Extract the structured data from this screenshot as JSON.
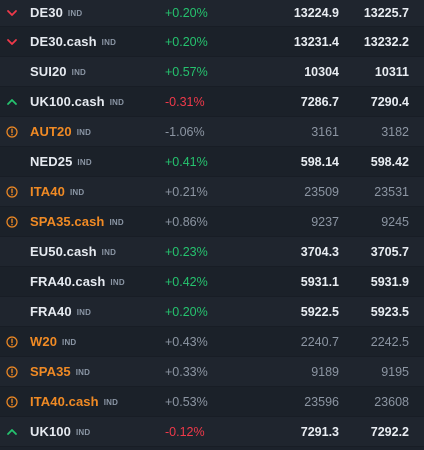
{
  "colors": {
    "positive": "#25c26e",
    "negative": "#f0394a",
    "warning": "#f08a24",
    "muted": "#8c95a2",
    "text": "#e6eaf0",
    "background": "#1c222b"
  },
  "rows": [
    {
      "icon": "chevron-down-icon",
      "symbol": "DE30",
      "tag": "IND",
      "change": "+0.20%",
      "change_dir": "pos",
      "bid": "13224.9",
      "ask": "13225.7",
      "warn": false,
      "dim": false
    },
    {
      "icon": "chevron-down-icon",
      "symbol": "DE30.cash",
      "tag": "IND",
      "change": "+0.20%",
      "change_dir": "pos",
      "bid": "13231.4",
      "ask": "13232.2",
      "warn": false,
      "dim": false
    },
    {
      "icon": "",
      "symbol": "SUI20",
      "tag": "IND",
      "change": "+0.57%",
      "change_dir": "pos",
      "bid": "10304",
      "ask": "10311",
      "warn": false,
      "dim": false
    },
    {
      "icon": "chevron-up-icon",
      "symbol": "UK100.cash",
      "tag": "IND",
      "change": "-0.31%",
      "change_dir": "neg",
      "bid": "7286.7",
      "ask": "7290.4",
      "warn": false,
      "dim": false
    },
    {
      "icon": "info-circle-icon",
      "symbol": "AUT20",
      "tag": "IND",
      "change": "-1.06%",
      "change_dir": "mute",
      "bid": "3161",
      "ask": "3182",
      "warn": true,
      "dim": true
    },
    {
      "icon": "",
      "symbol": "NED25",
      "tag": "IND",
      "change": "+0.41%",
      "change_dir": "pos",
      "bid": "598.14",
      "ask": "598.42",
      "warn": false,
      "dim": false
    },
    {
      "icon": "info-circle-icon",
      "symbol": "ITA40",
      "tag": "IND",
      "change": "+0.21%",
      "change_dir": "mute",
      "bid": "23509",
      "ask": "23531",
      "warn": true,
      "dim": true
    },
    {
      "icon": "info-circle-icon",
      "symbol": "SPA35.cash",
      "tag": "IND",
      "change": "+0.86%",
      "change_dir": "mute",
      "bid": "9237",
      "ask": "9245",
      "warn": true,
      "dim": true
    },
    {
      "icon": "",
      "symbol": "EU50.cash",
      "tag": "IND",
      "change": "+0.23%",
      "change_dir": "pos",
      "bid": "3704.3",
      "ask": "3705.7",
      "warn": false,
      "dim": false
    },
    {
      "icon": "",
      "symbol": "FRA40.cash",
      "tag": "IND",
      "change": "+0.42%",
      "change_dir": "pos",
      "bid": "5931.1",
      "ask": "5931.9",
      "warn": false,
      "dim": false
    },
    {
      "icon": "",
      "symbol": "FRA40",
      "tag": "IND",
      "change": "+0.20%",
      "change_dir": "pos",
      "bid": "5922.5",
      "ask": "5923.5",
      "warn": false,
      "dim": false
    },
    {
      "icon": "info-circle-icon",
      "symbol": "W20",
      "tag": "IND",
      "change": "+0.43%",
      "change_dir": "mute",
      "bid": "2240.7",
      "ask": "2242.5",
      "warn": true,
      "dim": true
    },
    {
      "icon": "info-circle-icon",
      "symbol": "SPA35",
      "tag": "IND",
      "change": "+0.33%",
      "change_dir": "mute",
      "bid": "9189",
      "ask": "9195",
      "warn": true,
      "dim": true
    },
    {
      "icon": "info-circle-icon",
      "symbol": "ITA40.cash",
      "tag": "IND",
      "change": "+0.53%",
      "change_dir": "mute",
      "bid": "23596",
      "ask": "23608",
      "warn": true,
      "dim": true
    },
    {
      "icon": "chevron-up-icon",
      "symbol": "UK100",
      "tag": "IND",
      "change": "-0.12%",
      "change_dir": "neg",
      "bid": "7291.3",
      "ask": "7292.2",
      "warn": false,
      "dim": false
    }
  ]
}
